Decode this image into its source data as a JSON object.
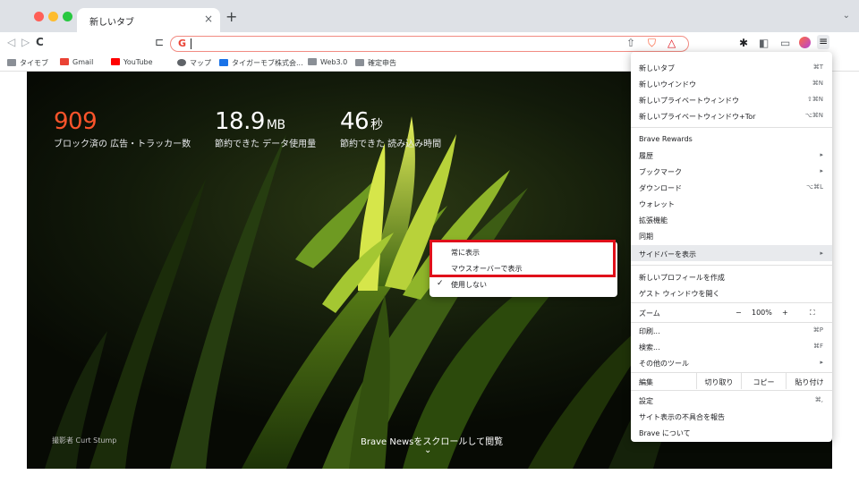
{
  "tab": {
    "title": "新しいタブ",
    "close": "×",
    "new_tab": "+",
    "tab_search": "⌄"
  },
  "toolbar": {
    "back": "◁",
    "forward": "▷",
    "reload": "C",
    "bookmark": "⊏",
    "g": "G",
    "share": "⇧",
    "shield": "⛉",
    "rewards": "△",
    "extensions": "✱",
    "sidebar": "◧",
    "wallet": "▭",
    "menu": "≡"
  },
  "bookmarks": [
    {
      "label": "タイモブ",
      "icon_color": "#8a8f96"
    },
    {
      "label": "Gmail",
      "icon_color": "#ea4335"
    },
    {
      "label": "YouTube",
      "icon_color": "#ff0000"
    },
    {
      "label": "マップ",
      "icon_color": "#5f6368"
    },
    {
      "label": "タイガーモブ株式会...",
      "icon_color": "#1a73e8"
    },
    {
      "label": "Web3.0",
      "icon_color": "#8a8f96"
    },
    {
      "label": "確定申告",
      "icon_color": "#8a8f96"
    }
  ],
  "stats": [
    {
      "value": "909",
      "unit": "",
      "label": "ブロック済の 広告・トラッカー数",
      "color": "#fb542b"
    },
    {
      "value": "18.9",
      "unit": "MB",
      "label": "節約できた データ使用量",
      "color": "#ffffff"
    },
    {
      "value": "46",
      "unit": "秒",
      "label": "節約できた 読み込み時間",
      "color": "#ffffff"
    }
  ],
  "content": {
    "photo_credit": "撮影者 Curt Stump",
    "news": "Brave Newsをスクロールして閲覧",
    "news_chevron": "⌄"
  },
  "submenu": [
    {
      "label": "常に表示",
      "checked": false
    },
    {
      "label": "マウスオーバーで表示",
      "checked": false
    },
    {
      "label": "使用しない",
      "checked": true
    }
  ],
  "menu": {
    "group1": [
      {
        "label": "新しいタブ",
        "shortcut": "⌘T"
      },
      {
        "label": "新しいウインドウ",
        "shortcut": "⌘N"
      },
      {
        "label": "新しいプライベートウィンドウ",
        "shortcut": "⇧⌘N"
      },
      {
        "label": "新しいプライベートウィンドウ+Tor",
        "shortcut": "⌥⌘N"
      }
    ],
    "group2": [
      {
        "label": "Brave Rewards",
        "shortcut": ""
      },
      {
        "label": "履歴",
        "shortcut": "▸"
      },
      {
        "label": "ブックマーク",
        "shortcut": "▸"
      },
      {
        "label": "ダウンロード",
        "shortcut": "⌥⌘L"
      },
      {
        "label": "ウォレット",
        "shortcut": ""
      },
      {
        "label": "拡張機能",
        "shortcut": ""
      },
      {
        "label": "同期",
        "shortcut": ""
      },
      {
        "label": "サイドバーを表示",
        "shortcut": "▸"
      }
    ],
    "group3": [
      {
        "label": "新しいプロフィールを作成",
        "shortcut": ""
      },
      {
        "label": "ゲスト ウィンドウを開く",
        "shortcut": ""
      }
    ],
    "zoom": {
      "label": "ズーム",
      "minus": "−",
      "value": "100%",
      "plus": "+",
      "fullscreen": "⛶"
    },
    "group4": [
      {
        "label": "印刷...",
        "shortcut": "⌘P"
      },
      {
        "label": "検索...",
        "shortcut": "⌘F"
      },
      {
        "label": "その他のツール",
        "shortcut": "▸"
      }
    ],
    "edit": {
      "label": "編集",
      "cut": "切り取り",
      "copy": "コピー",
      "paste": "貼り付け"
    },
    "group5": [
      {
        "label": "設定",
        "shortcut": "⌘,"
      },
      {
        "label": "サイト表示の不具合を報告",
        "shortcut": ""
      },
      {
        "label": "Brave について",
        "shortcut": ""
      }
    ]
  }
}
